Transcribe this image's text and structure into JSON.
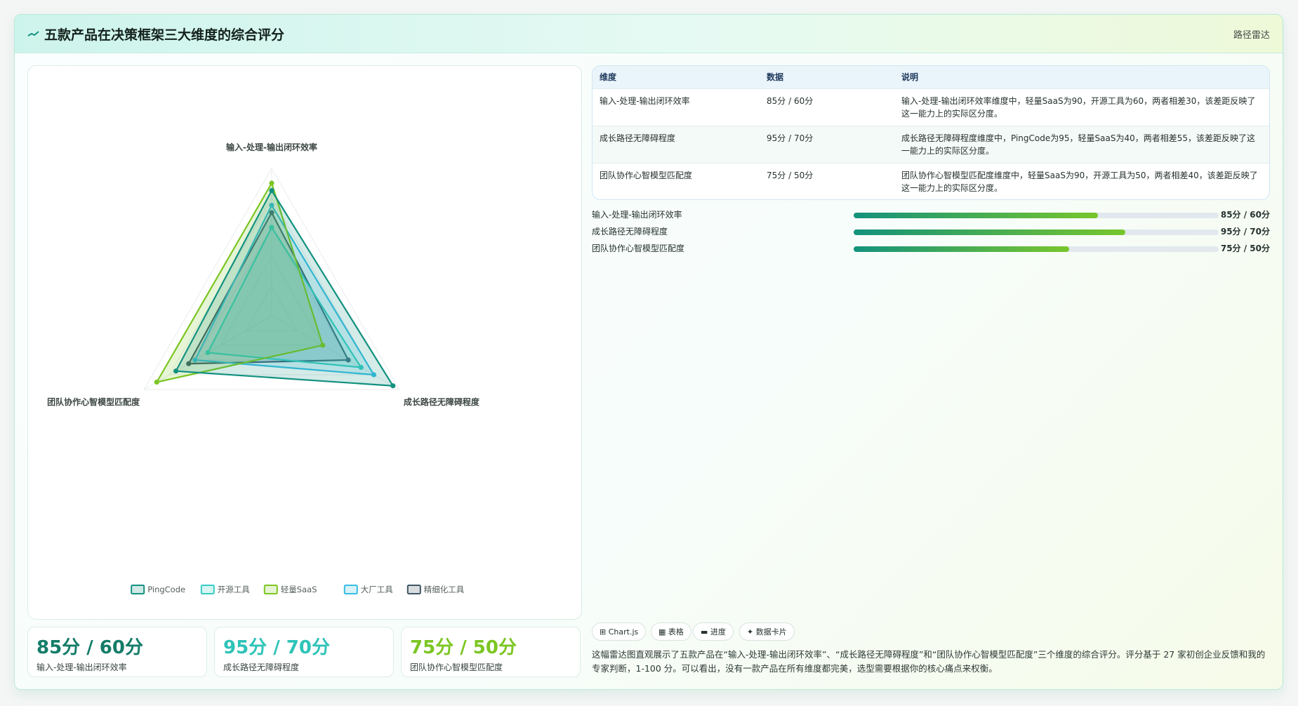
{
  "header": {
    "title": "五款产品在决策框架三大维度的综合评分",
    "tag": "路径雷达"
  },
  "chart_data": {
    "type": "radar",
    "axes": [
      "输入-处理-输出闭环效率",
      "成长路径无障碍程度",
      "团队协作心智模型匹配度"
    ],
    "range": [
      0,
      100
    ],
    "grid": true,
    "legend_position": "bottom",
    "series": [
      {
        "name": "PingCode",
        "values": [
          85,
          95,
          75
        ],
        "color": "#139180"
      },
      {
        "name": "开源工具",
        "values": [
          60,
          70,
          50
        ],
        "color": "#36cdc4"
      },
      {
        "name": "轻量SaaS",
        "values": [
          90,
          40,
          90
        ],
        "color": "#7cc623"
      },
      {
        "name": "大厂工具",
        "values": [
          75,
          80,
          60
        ],
        "color": "#38bde3"
      },
      {
        "name": "精细化工具",
        "values": [
          70,
          60,
          65
        ],
        "color": "#3f5563"
      }
    ]
  },
  "kpis": [
    {
      "value": "85分 / 60分",
      "label": "输入-处理-输出闭环效率",
      "color": "#137c68"
    },
    {
      "value": "95分 / 70分",
      "label": "成长路径无障碍程度",
      "color": "#2ec3b8"
    },
    {
      "value": "75分 / 50分",
      "label": "团队协作心智模型匹配度",
      "color": "#7cc623"
    }
  ],
  "table": {
    "headers": [
      "维度",
      "数据",
      "说明"
    ],
    "rows": [
      {
        "dim": "输入-处理-输出闭环效率",
        "data": "85分 / 60分",
        "note": "输入-处理-输出闭环效率维度中，轻量SaaS为90，开源工具为60，两者相差30，该差距反映了这一能力上的实际区分度。"
      },
      {
        "dim": "成长路径无障碍程度",
        "data": "95分 / 70分",
        "note": "成长路径无障碍程度维度中，PingCode为95，轻量SaaS为40，两者相差55，该差距反映了这一能力上的实际区分度。"
      },
      {
        "dim": "团队协作心智模型匹配度",
        "data": "75分 / 50分",
        "note": "团队协作心智模型匹配度维度中，轻量SaaS为90，开源工具为50，两者相差40，该差距反映了这一能力上的实际区分度。"
      }
    ]
  },
  "progress": [
    {
      "label": "输入-处理-输出闭环效率",
      "value_text": "85分 / 60分",
      "fraction": 0.67
    },
    {
      "label": "成长路径无障碍程度",
      "value_text": "95分 / 70分",
      "fraction": 0.745
    },
    {
      "label": "团队协作心智模型匹配度",
      "value_text": "75分 / 50分",
      "fraction": 0.59
    }
  ],
  "chips": [
    "⊞ Chart.js",
    "▦ 表格",
    "▬ 进度",
    "✦ 数据卡片"
  ],
  "description": "这幅雷达图直观展示了五款产品在“输入-处理-输出闭环效率”、“成长路径无障碍程度”和“团队协作心智模型匹配度”三个维度的综合评分。评分基于 27 家初创企业反馈和我的专家判断，1-100 分。可以看出，没有一款产品在所有维度都完美，选型需要根据你的核心痛点来权衡。"
}
